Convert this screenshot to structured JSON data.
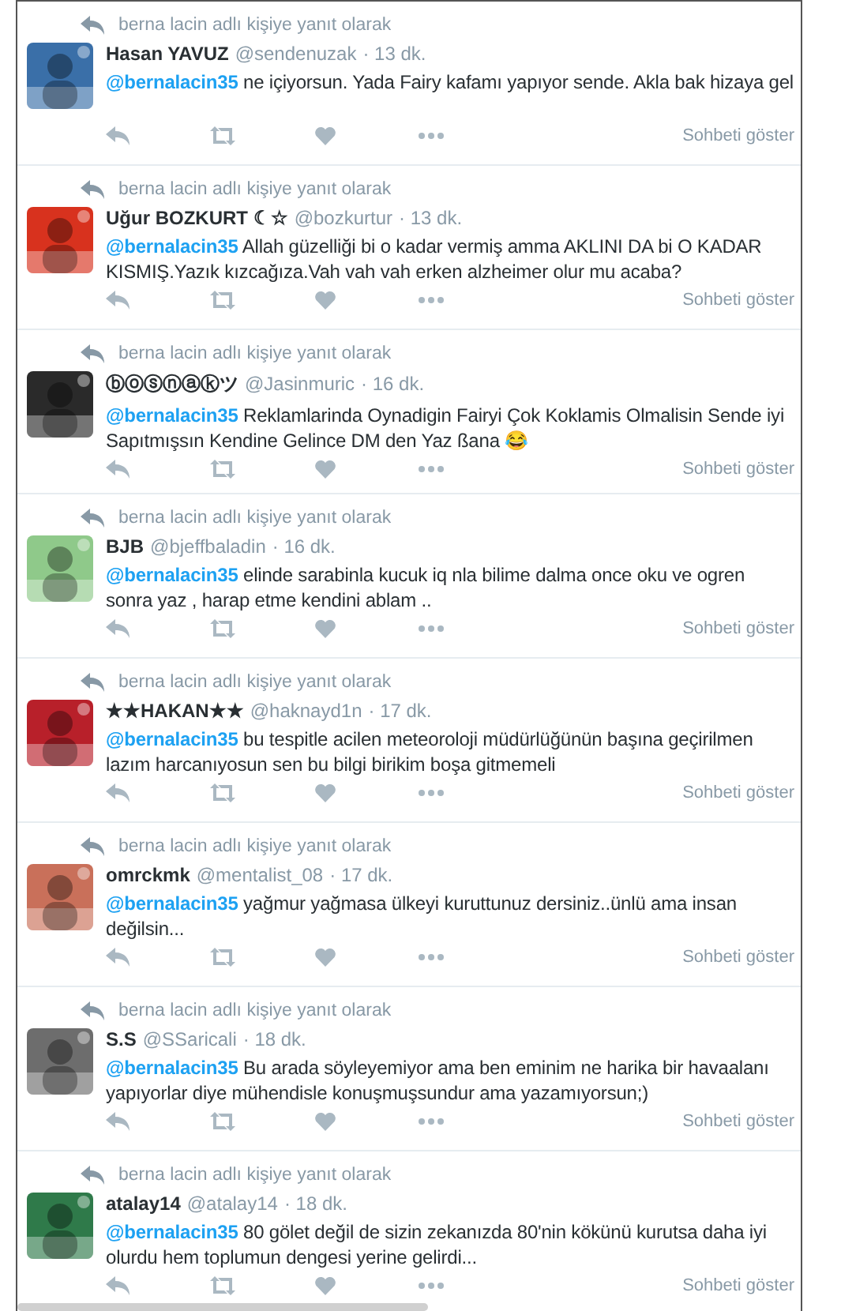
{
  "tweets": [
    {
      "context": "berna lacin adlı kişiye yanıt olarak",
      "name": "Hasan YAVUZ",
      "handle": "@sendenuzak",
      "time": "· 13 dk.",
      "mention": "@bernalacin35",
      "text": " ne içiyorsun. Yada Fairy kafamı yapıyor sende. Akla bak hizaya gel",
      "conversation": "Sohbeti göster"
    },
    {
      "context": "berna lacin adlı kişiye yanıt olarak",
      "name": "Uğur BOZKURT ☾☆",
      "handle": "@bozkurtur",
      "time": "· 13 dk.",
      "mention": "@bernalacin35",
      "text": " Allah güzelliği bi o kadar vermiş amma AKLINI DA bi O KADAR KISMIŞ.Yazık kızcağıza.Vah vah vah erken alzheimer olur mu acaba?",
      "conversation": "Sohbeti göster"
    },
    {
      "context": "berna lacin adlı kişiye yanıt olarak",
      "name": "ⓑⓞⓢⓝⓐⓚツ",
      "handle": "@Jasinmuric",
      "time": "· 16 dk.",
      "mention": "@bernalacin35",
      "text": "  Reklamlarinda Oynadigin Fairyi Çok Koklamis Olmalisin Sende iyi Sapıtmışsın Kendine Gelince DM den Yaz ßana 😂",
      "conversation": "Sohbeti göster"
    },
    {
      "context": "berna lacin adlı kişiye yanıt olarak",
      "name": "BJB",
      "handle": "@bjeffbaladin",
      "time": "· 16 dk.",
      "mention": "@bernalacin35",
      "text": " elinde sarabinla kucuk iq nla bilime dalma once oku ve ogren sonra yaz  , harap etme kendini ablam ..",
      "conversation": "Sohbeti göster"
    },
    {
      "context": "berna lacin adlı kişiye yanıt olarak",
      "name": "★★HAKAN★★",
      "handle": "@haknayd1n",
      "time": "· 17 dk.",
      "mention": "@bernalacin35",
      "text": " bu tespitle acilen meteoroloji müdürlüğünün başına geçirilmen lazım harcanıyosun sen bu bilgi birikim boşa gitmemeli",
      "conversation": "Sohbeti göster"
    },
    {
      "context": "berna lacin adlı kişiye yanıt olarak",
      "name": "omrckmk",
      "handle": "@mentalist_08",
      "time": "· 17 dk.",
      "mention": "@bernalacin35",
      "text": " yağmur yağmasa ülkeyi kuruttunuz dersiniz..ünlü ama insan değilsin...",
      "conversation": "Sohbeti göster"
    },
    {
      "context": "berna lacin adlı kişiye yanıt olarak",
      "name": "S.S",
      "handle": "@SSaricali",
      "time": "· 18 dk.",
      "mention": "@bernalacin35",
      "text": " Bu arada söyleyemiyor ama ben eminim ne harika bir havaalanı yapıyorlar diye mühendisle konuşmuşsundur ama yazamıyorsun;)",
      "conversation": "Sohbeti göster"
    },
    {
      "context": "berna lacin adlı kişiye yanıt olarak",
      "name": "atalay14",
      "handle": "@atalay14",
      "time": "· 18 dk.",
      "mention": "@bernalacin35",
      "text": " 80 gölet değil de sizin zekanızda 80'nin kökünü kurutsa daha iyi olurdu hem toplumun dengesi yerine gelirdi...",
      "conversation": "Sohbeti göster"
    }
  ]
}
